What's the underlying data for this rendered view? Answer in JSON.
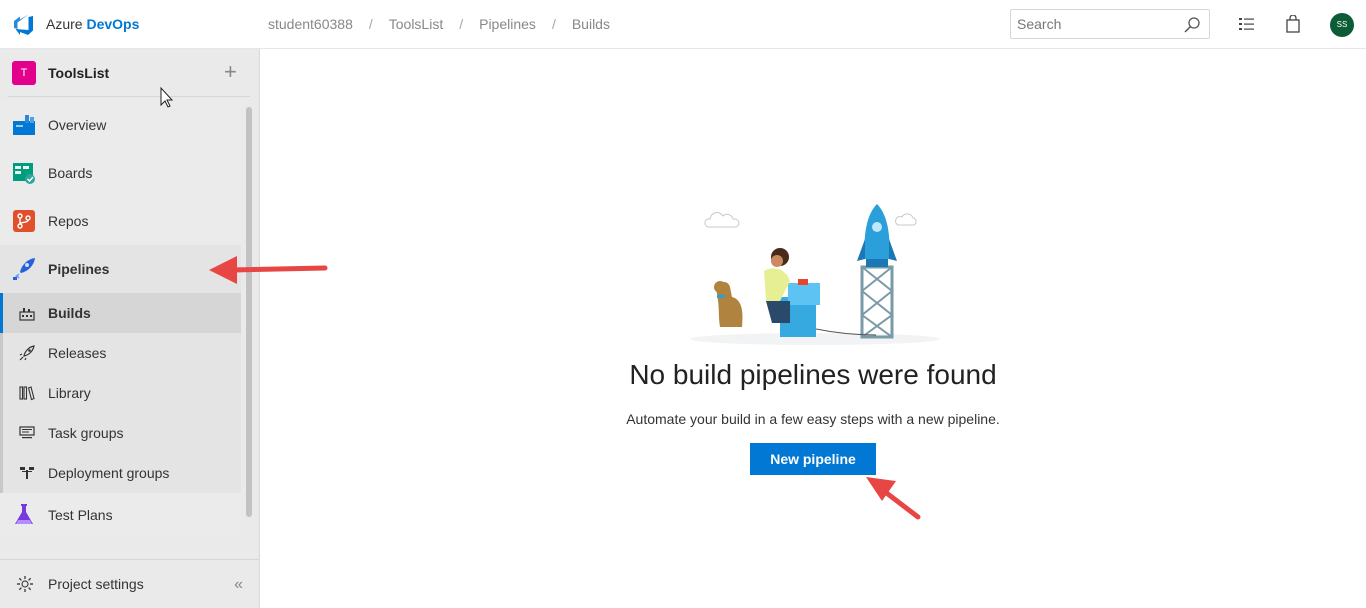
{
  "header": {
    "brand_prefix": "Azure",
    "brand_suffix": "DevOps",
    "breadcrumb": [
      "student60388",
      "ToolsList",
      "Pipelines",
      "Builds"
    ],
    "search_placeholder": "Search",
    "avatar_initials": "SS",
    "avatar_color": "#0b5c37"
  },
  "sidebar": {
    "project_initial": "T",
    "project_name": "ToolsList",
    "project_color": "#e3008c",
    "items": [
      {
        "label": "Overview",
        "icon": "overview-icon"
      },
      {
        "label": "Boards",
        "icon": "boards-icon"
      },
      {
        "label": "Repos",
        "icon": "repos-icon"
      },
      {
        "label": "Pipelines",
        "icon": "pipelines-icon"
      }
    ],
    "pipelines_sub": [
      {
        "label": "Builds",
        "icon": "builds-icon"
      },
      {
        "label": "Releases",
        "icon": "rocket-icon"
      },
      {
        "label": "Library",
        "icon": "library-icon"
      },
      {
        "label": "Task groups",
        "icon": "task-groups-icon"
      },
      {
        "label": "Deployment groups",
        "icon": "deployment-groups-icon"
      }
    ],
    "test_plans_label": "Test Plans",
    "settings_label": "Project settings"
  },
  "main": {
    "empty_title": "No build pipelines were found",
    "empty_subtitle": "Automate your build in a few easy steps with a new pipeline.",
    "new_pipeline_label": "New pipeline",
    "accent": "#0078d4"
  }
}
